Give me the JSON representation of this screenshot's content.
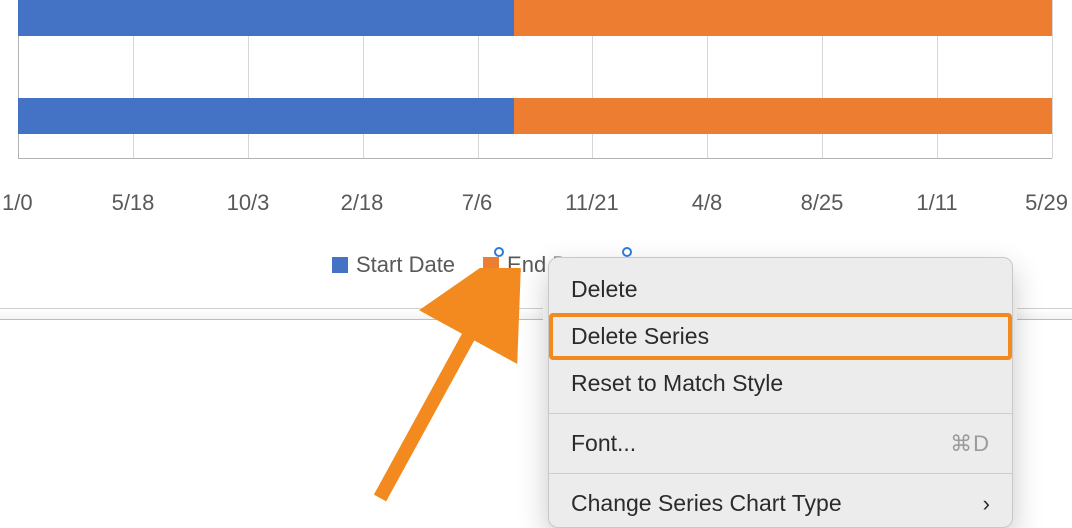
{
  "chart_data": {
    "type": "bar",
    "orientation": "horizontal-stacked",
    "x_ticks": [
      "1/0",
      "5/18",
      "10/3",
      "2/18",
      "7/6",
      "11/21",
      "4/8",
      "8/25",
      "1/11",
      "5/29"
    ],
    "series": [
      {
        "name": "Start Date",
        "color": "#4472c4"
      },
      {
        "name": "End Date",
        "color": "#ed7d31"
      }
    ],
    "rows": [
      {
        "segments": [
          {
            "series": "Start Date",
            "frac": 0.48
          },
          {
            "series": "End Date",
            "frac": 0.52
          }
        ]
      },
      {
        "segments": [
          {
            "series": "Start Date",
            "frac": 0.48
          },
          {
            "series": "End Date",
            "frac": 0.52
          }
        ]
      }
    ],
    "legend": {
      "position": "bottom",
      "selected": "End Date"
    }
  },
  "legend": {
    "item1": {
      "label": "Start Date",
      "color": "#4472c4"
    },
    "item2": {
      "label": "End Date",
      "color": "#ed7d31"
    }
  },
  "context_menu": {
    "highlighted": "delete_series",
    "items": {
      "delete": {
        "label": "Delete"
      },
      "delete_series": {
        "label": "Delete Series"
      },
      "reset_style": {
        "label": "Reset to Match Style"
      },
      "font": {
        "label": "Font...",
        "shortcut": "⌘D"
      },
      "change_type": {
        "label": "Change Series Chart Type"
      }
    }
  },
  "annotation": {
    "arrow_color": "#f28a1f",
    "highlight_color": "#f28a1f"
  }
}
